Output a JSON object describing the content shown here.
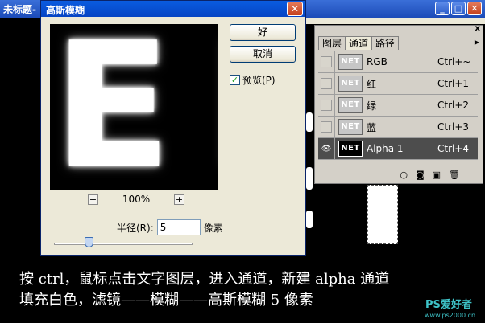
{
  "document": {
    "title": "未标题-",
    "controls": {
      "minimize": "_",
      "maximize": "□",
      "close": "✕"
    }
  },
  "dialog": {
    "title": "高斯模糊",
    "close_icon": "close-icon",
    "preview_letters": [
      "E",
      "E"
    ],
    "ok_label": "好",
    "cancel_label": "取消",
    "preview_check": "✓",
    "preview_label": "预览(P)",
    "zoom_out": "−",
    "zoom_in": "+",
    "zoom_level": "100%",
    "radius_label": "半径(R):",
    "radius_value": "5",
    "radius_unit": "像素",
    "slider_position": 0.25
  },
  "channels_panel": {
    "close": "x",
    "menu_icon": "▶",
    "tabs": [
      {
        "label": "图层",
        "active": false
      },
      {
        "label": "通道",
        "active": true
      },
      {
        "label": "路径",
        "active": false
      }
    ],
    "channels": [
      {
        "thumb": "NET",
        "name": "RGB",
        "shortcut": "Ctrl+~",
        "selected": false,
        "visible": false
      },
      {
        "thumb": "NET",
        "name": "红",
        "shortcut": "Ctrl+1",
        "selected": false,
        "visible": false
      },
      {
        "thumb": "NET",
        "name": "绿",
        "shortcut": "Ctrl+2",
        "selected": false,
        "visible": false
      },
      {
        "thumb": "NET",
        "name": "蓝",
        "shortcut": "Ctrl+3",
        "selected": false,
        "visible": false
      },
      {
        "thumb": "NET",
        "name": "Alpha 1",
        "shortcut": "Ctrl+4",
        "selected": true,
        "visible": true
      }
    ],
    "eye_icon": "👁",
    "footer_icons": {
      "load_selection": "○",
      "save_selection": "◙",
      "new_channel": "▣",
      "delete": "🗑"
    }
  },
  "caption": {
    "line1": "按 ctrl，鼠标点击文字图层，进入通道，新建 alpha 通道",
    "line2": "填充白色，滤镜——模糊——高斯模糊 5 像素"
  },
  "watermark": {
    "logo": "PS爱好者",
    "url": "www.ps2000.cn"
  },
  "colors": {
    "titlebar": "#1c4bb8",
    "dialog_bg": "#ece9d8",
    "panel_bg": "#d4d0c8",
    "selected_row": "#4d4d4d",
    "watermark": "#3ec3c8"
  }
}
